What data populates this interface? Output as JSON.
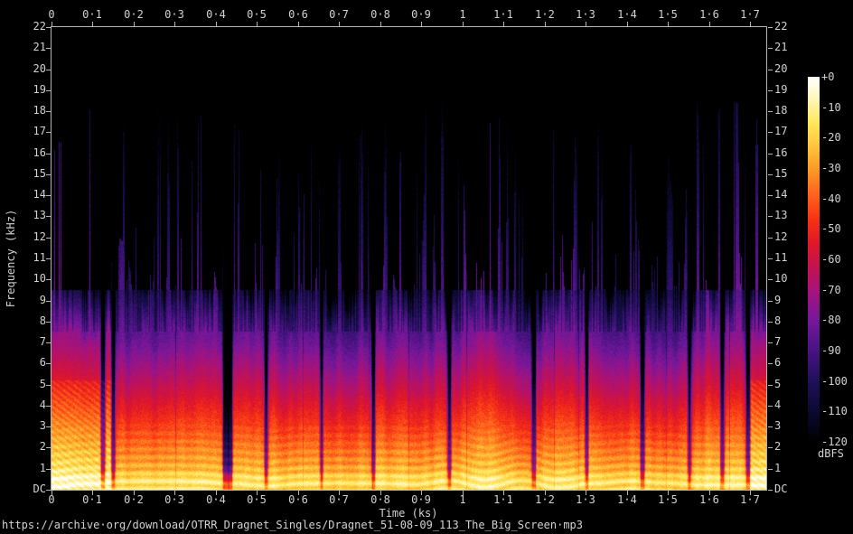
{
  "footer_url": "https://archive·org/download/OTRR_Dragnet_Singles/Dragnet_51-08-09_113_The_Big_Screen·mp3",
  "chart_data": {
    "type": "heatmap",
    "subtype": "audio-spectrogram",
    "xlabel": "Time (ks)",
    "ylabel": "Frequency (kHz)",
    "colorbar_label": "dBFS",
    "x_range_ks": [
      0,
      1.74
    ],
    "y_range_khz": [
      0,
      22
    ],
    "db_range": [
      -120,
      0
    ],
    "x_ticks": [
      "0",
      "0·1",
      "0·2",
      "0·3",
      "0·4",
      "0·5",
      "0·6",
      "0·7",
      "0·8",
      "0·9",
      "1",
      "1·1",
      "1·2",
      "1·3",
      "1·4",
      "1·5",
      "1·6",
      "1·7"
    ],
    "x_tick_values": [
      0,
      0.1,
      0.2,
      0.3,
      0.4,
      0.5,
      0.6,
      0.7,
      0.8,
      0.9,
      1,
      1.1,
      1.2,
      1.3,
      1.4,
      1.5,
      1.6,
      1.7
    ],
    "y_ticks": [
      "22",
      "21",
      "20",
      "19",
      "18",
      "17",
      "16",
      "15",
      "14",
      "13",
      "12",
      "11",
      "10",
      "9",
      "8",
      "7",
      "6",
      "5",
      "4",
      "3",
      "2",
      "1",
      "DC"
    ],
    "y_tick_values": [
      22,
      21,
      20,
      19,
      18,
      17,
      16,
      15,
      14,
      13,
      12,
      11,
      10,
      9,
      8,
      7,
      6,
      5,
      4,
      3,
      2,
      1,
      0
    ],
    "colorbar_ticks": [
      "+0",
      "-10",
      "-20",
      "-30",
      "-40",
      "-50",
      "-60",
      "-70",
      "-80",
      "-90",
      "-100",
      "-110",
      "-120"
    ],
    "colorbar_tick_values": [
      0,
      -10,
      -20,
      -30,
      -40,
      -50,
      -60,
      -70,
      -80,
      -90,
      -100,
      -110,
      -120
    ],
    "grid": false,
    "legend_position": "right-colorbar",
    "palette": [
      {
        "db": 0,
        "color": "#ffffff"
      },
      {
        "db": -7,
        "color": "#fff6bd"
      },
      {
        "db": -15,
        "color": "#ffe95a"
      },
      {
        "db": -23,
        "color": "#ffc43a"
      },
      {
        "db": -31,
        "color": "#ff9524"
      },
      {
        "db": -39,
        "color": "#ff611b"
      },
      {
        "db": -47,
        "color": "#f63114"
      },
      {
        "db": -55,
        "color": "#df1629"
      },
      {
        "db": -63,
        "color": "#c21253"
      },
      {
        "db": -71,
        "color": "#a3137e"
      },
      {
        "db": -80,
        "color": "#75189b"
      },
      {
        "db": -90,
        "color": "#471382"
      },
      {
        "db": -100,
        "color": "#201058"
      },
      {
        "db": -110,
        "color": "#0b0a31"
      },
      {
        "db": -120,
        "color": "#000000"
      }
    ],
    "segments": [
      {
        "type": "music",
        "start_ks": 0.0,
        "end_ks": 0.145
      },
      {
        "type": "speech",
        "start_ks": 0.154,
        "end_ks": 1.692
      },
      {
        "type": "music",
        "start_ks": 1.7,
        "end_ks": 1.74
      }
    ],
    "quiet_gaps_ks": [
      [
        0.121,
        0.13
      ],
      [
        0.147,
        0.154
      ],
      [
        0.418,
        0.44
      ],
      [
        0.52,
        0.526
      ],
      [
        0.655,
        0.66
      ],
      [
        0.78,
        0.787
      ],
      [
        0.965,
        0.972
      ],
      [
        1.17,
        1.178
      ],
      [
        1.3,
        1.306
      ],
      [
        1.435,
        1.443
      ],
      [
        1.55,
        1.556
      ],
      [
        1.63,
        1.637
      ],
      [
        1.692,
        1.7
      ]
    ],
    "tall_spike_times_ks": [
      0.004,
      0.02,
      0.09,
      0.175,
      0.26,
      0.305,
      0.36,
      0.445,
      0.555,
      0.63,
      0.7,
      0.745,
      0.755,
      0.77,
      0.85,
      0.95,
      1.07,
      1.13,
      1.22,
      1.33,
      1.41,
      1.5,
      1.585,
      1.66,
      1.715
    ],
    "observed_bands": [
      {
        "khz": [
          0,
          1.3
        ],
        "typical_dbfs": [
          -25,
          -12
        ]
      },
      {
        "khz": [
          1.3,
          2.5
        ],
        "typical_dbfs": [
          -38,
          -25
        ]
      },
      {
        "khz": [
          2.5,
          4.5
        ],
        "typical_dbfs": [
          -58,
          -38
        ]
      },
      {
        "khz": [
          4.5,
          7
        ],
        "typical_dbfs": [
          -80,
          -58
        ]
      },
      {
        "khz": [
          7,
          9.5
        ],
        "typical_dbfs": [
          -100,
          -80
        ]
      },
      {
        "khz": [
          9.5,
          18
        ],
        "typical_dbfs": [
          -120,
          -95
        ]
      }
    ],
    "accent_colors": {
      "axis": "#b4b4b4",
      "text": "#d2d2d2",
      "background": "#000000"
    }
  }
}
